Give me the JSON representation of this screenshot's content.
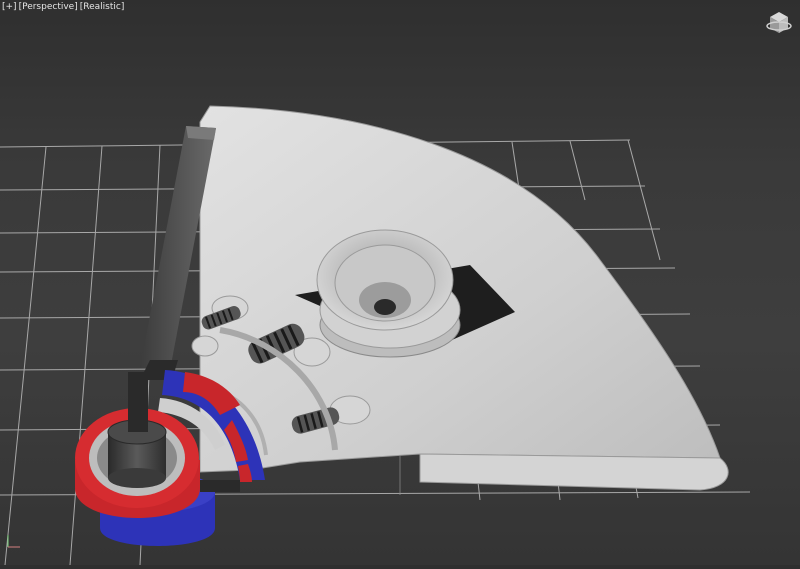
{
  "viewport": {
    "label_parts": [
      "[+]",
      "[Perspective]",
      "[Realistic]"
    ],
    "background": "#3a3a3a",
    "grid_color": "#a9a9a9",
    "mesh_color": "#d0d0d0",
    "accent_red": "#c8262b",
    "accent_blue": "#2d33b8"
  },
  "navigation": {
    "viewcube_icon": "viewcube-home-icon",
    "axis_icon": "axis-tripod-icon"
  }
}
